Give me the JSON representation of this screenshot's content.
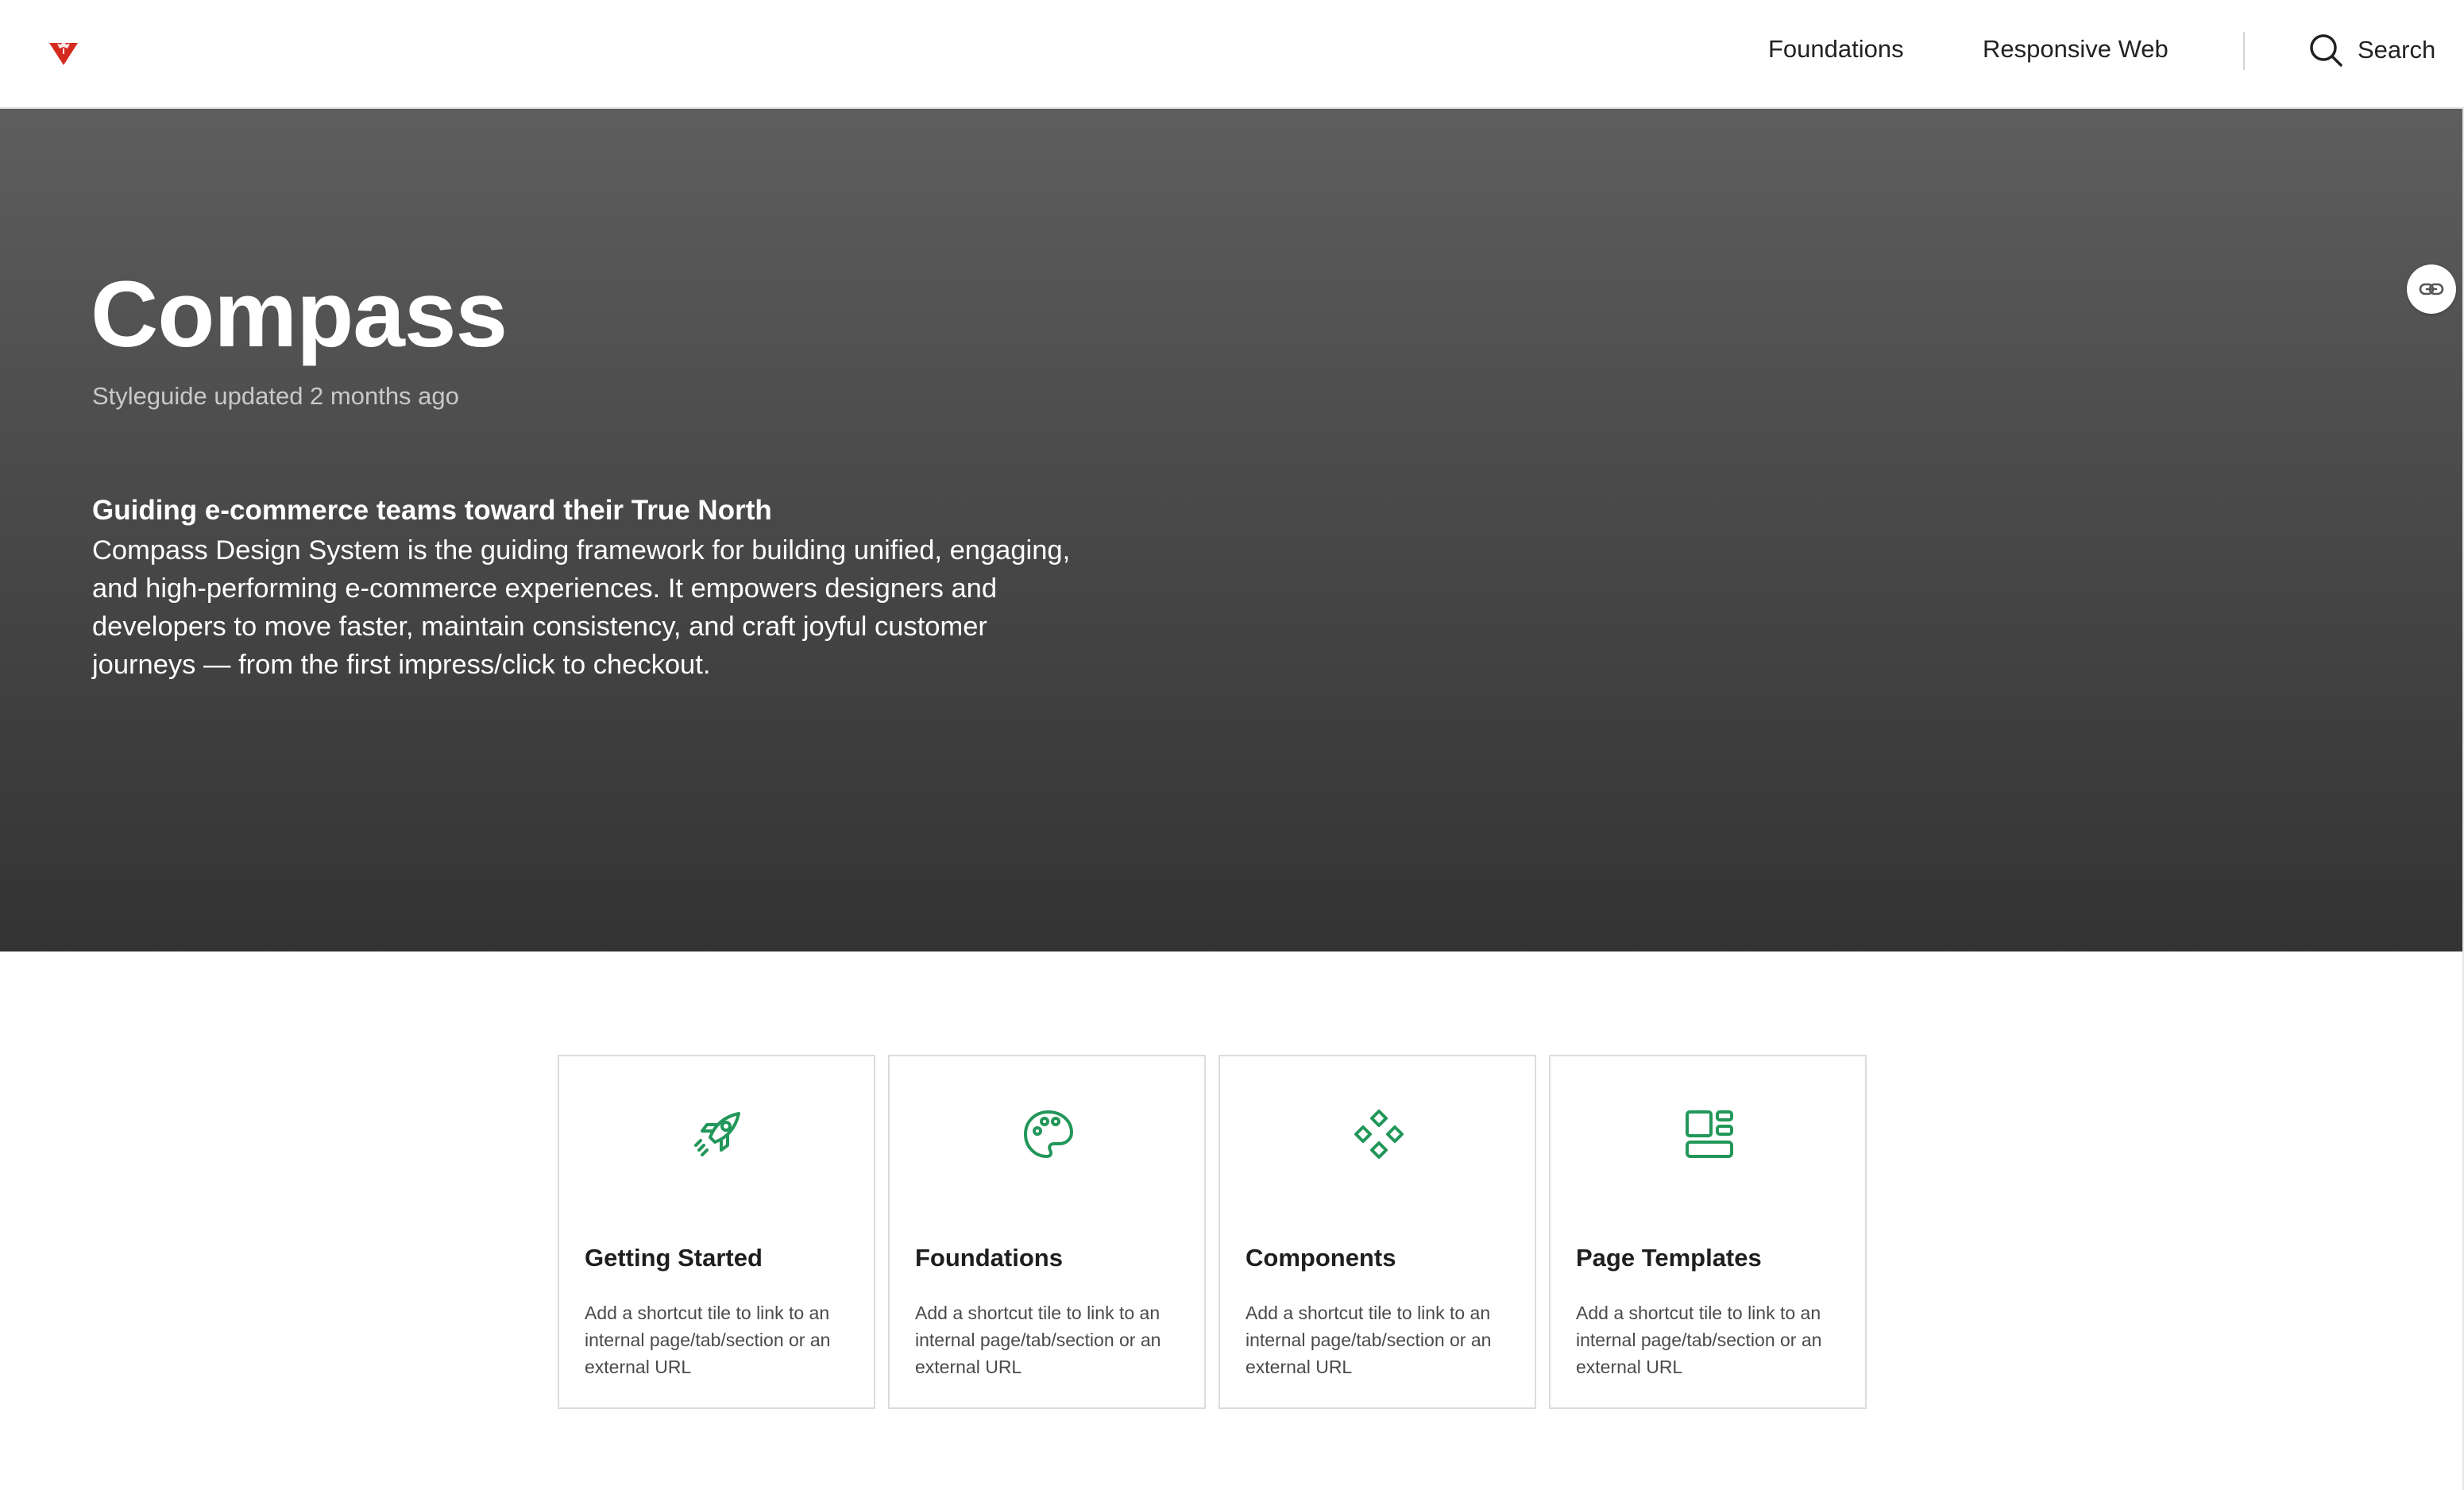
{
  "header": {
    "logo_icon": "maple-leaf-triangle-icon",
    "brand_color": "#d52b1e",
    "nav": [
      {
        "label": "Foundations"
      },
      {
        "label": "Responsive Web"
      }
    ],
    "search_label": "Search",
    "search_icon": "search-icon"
  },
  "hero": {
    "title": "Compass",
    "updated": "Styleguide updated 2 months ago",
    "heading": "Guiding e-commerce teams toward their True North",
    "body": "Compass Design System is the guiding framework for building unified, engaging, and high-performing e-commerce experiences. It empowers designers and developers to move faster, maintain consistency, and craft joyful customer journeys — from the first impress/click to checkout.",
    "link_icon": "link-icon"
  },
  "tiles": [
    {
      "title": "Getting Started",
      "description": "Add a shortcut tile to link to an internal page/tab/section or an external URL",
      "icon": "rocket-icon"
    },
    {
      "title": "Foundations",
      "description": "Add a shortcut tile to link to an internal page/tab/section or an external URL",
      "icon": "palette-icon"
    },
    {
      "title": "Components",
      "description": "Add a shortcut tile to link to an internal page/tab/section or an external URL",
      "icon": "components-icon"
    },
    {
      "title": "Page Templates",
      "description": "Add a shortcut tile to link to an internal page/tab/section or an external URL",
      "icon": "template-layout-icon"
    }
  ],
  "colors": {
    "accent_green": "#22975a",
    "hero_top": "#5e5e5e",
    "hero_bottom": "#333333"
  }
}
